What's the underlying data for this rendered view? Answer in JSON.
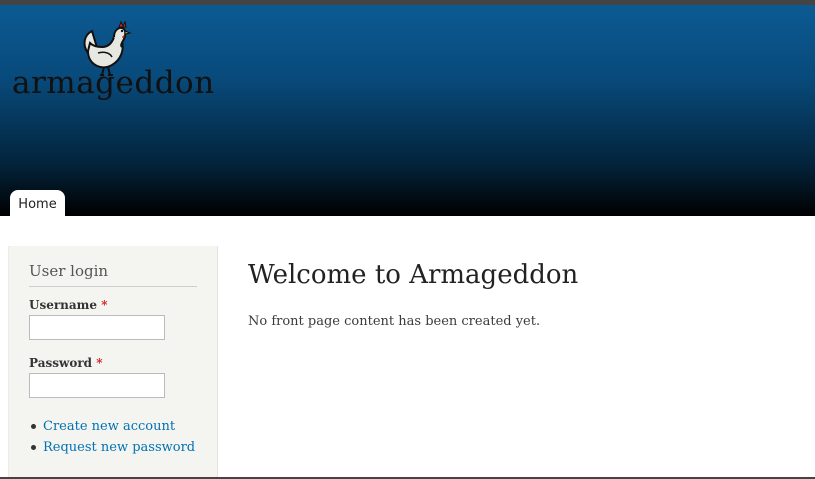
{
  "site": {
    "name": "armageddon"
  },
  "nav": {
    "tabs": [
      {
        "label": "Home",
        "active": true
      }
    ]
  },
  "login": {
    "title": "User login",
    "username_label": "Username",
    "password_label": "Password",
    "required_mark": "*",
    "username_value": "",
    "password_value": "",
    "links": [
      "Create new account",
      "Request new password"
    ]
  },
  "main": {
    "title": "Welcome to Armageddon",
    "text": "No front page content has been created yet."
  },
  "colors": {
    "header_top": "#0c5a93",
    "header_bottom": "#000000",
    "link": "#0071b3",
    "required": "#cc2222",
    "sidebar_bg": "#f4f4f1"
  }
}
